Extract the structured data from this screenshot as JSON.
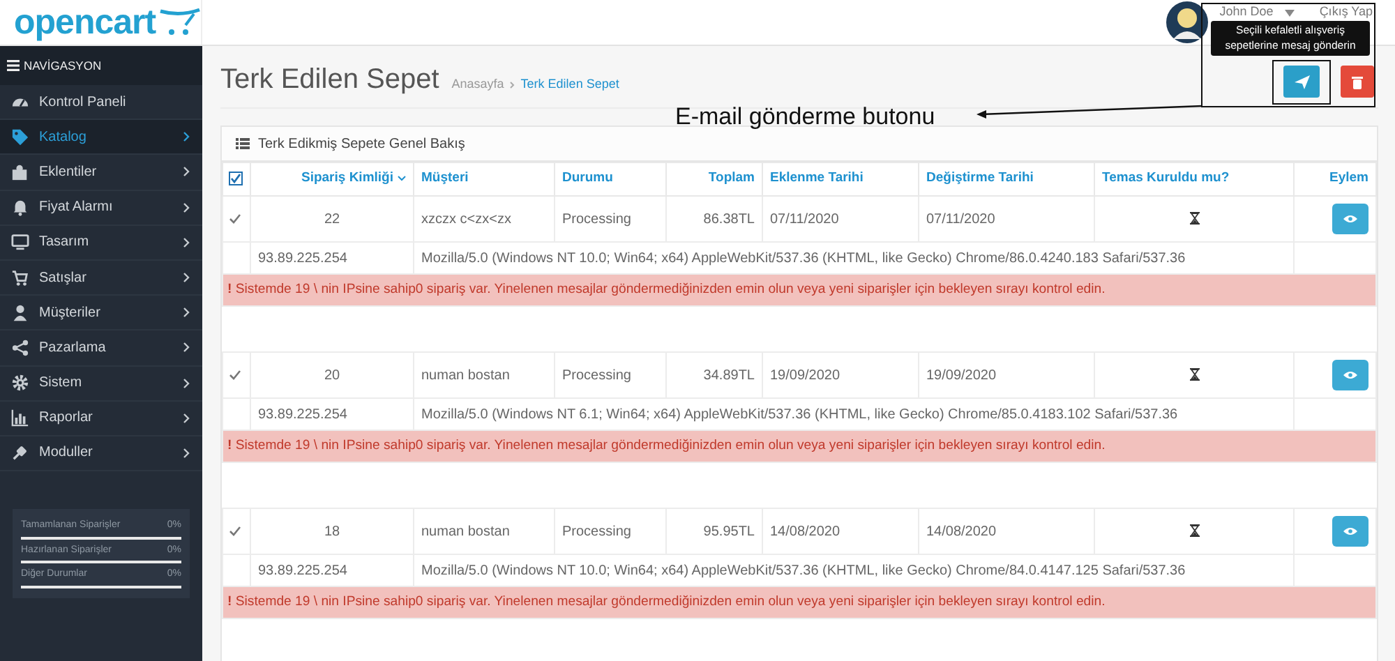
{
  "header": {
    "logo": "opencart",
    "user": "John Doe",
    "logout": "Çıkış Yap"
  },
  "sidebar": {
    "heading": "NAVİGASYON",
    "items": [
      {
        "label": "Kontrol Paneli",
        "selected": false,
        "has_children": false
      },
      {
        "label": "Katalog",
        "selected": true,
        "has_children": true
      },
      {
        "label": "Eklentiler",
        "selected": false,
        "has_children": true
      },
      {
        "label": "Fiyat Alarmı",
        "selected": false,
        "has_children": true
      },
      {
        "label": "Tasarım",
        "selected": false,
        "has_children": true
      },
      {
        "label": "Satışlar",
        "selected": false,
        "has_children": true
      },
      {
        "label": "Müşteriler",
        "selected": false,
        "has_children": true
      },
      {
        "label": "Pazarlama",
        "selected": false,
        "has_children": true
      },
      {
        "label": "Sistem",
        "selected": false,
        "has_children": true
      },
      {
        "label": "Raporlar",
        "selected": false,
        "has_children": true
      },
      {
        "label": "Moduller",
        "selected": false,
        "has_children": true
      }
    ],
    "stats": [
      {
        "label": "Tamamlanan Siparişler",
        "value": "0%",
        "level": 0
      },
      {
        "label": "Hazırlanan Siparişler",
        "value": "0%",
        "level": 0
      },
      {
        "label": "Diğer Durumlar",
        "value": "0%",
        "level": 0
      }
    ]
  },
  "page": {
    "title": "Terk Edilen Sepet",
    "breadcrumb": [
      {
        "label": "Anasayfa",
        "selected": false
      },
      {
        "label": "Terk Edilen Sepet",
        "selected": true
      }
    ]
  },
  "toolbar": {
    "tooltip": "Seçili kefaletli alışveriş sepetlerine mesaj gönderin"
  },
  "annotation": {
    "label": "E-mail gönderme butonu"
  },
  "panel": {
    "title": "Terk Edikmiş Sepete Genel Bakış",
    "select_all_checked": true,
    "columns": [
      {
        "label": "Sipariş Kimliği",
        "sorted": true
      },
      {
        "label": "Müşteri",
        "sorted": false
      },
      {
        "label": "Durumu",
        "sorted": false
      },
      {
        "label": "Toplam",
        "sorted": false
      },
      {
        "label": "Eklenme Tarihi",
        "sorted": false
      },
      {
        "label": "Değiştirme Tarihi",
        "sorted": false
      },
      {
        "label": "Temas Kuruldu mu?",
        "sorted": false
      },
      {
        "label": "Eylem",
        "sorted": false
      }
    ],
    "rows": [
      {
        "checked": true,
        "id": "22",
        "customer": "xzczx c<zx<zx",
        "status": "Processing",
        "total": "86.38TL",
        "added": "07/11/2020",
        "modified": "07/11/2020",
        "contacted": false,
        "ip": "93.89.225.254",
        "user_agent": "Mozilla/5.0 (Windows NT 10.0; Win64; x64) AppleWebKit/537.36 (KHTML, like Gecko) Chrome/86.0.4240.183 Safari/537.36",
        "alert": "**!** Sistemde 19 \\ nin IPsine sahip0 sipariş var. Yinelenen mesajlar göndermediğinizden emin olun veya yeni siparişler için bekleyen sırayı kontrol edin."
      },
      {
        "checked": true,
        "id": "20",
        "customer": "numan bostan",
        "status": "Processing",
        "total": "34.89TL",
        "added": "19/09/2020",
        "modified": "19/09/2020",
        "contacted": false,
        "ip": "93.89.225.254",
        "user_agent": "Mozilla/5.0 (Windows NT 6.1; Win64; x64) AppleWebKit/537.36 (KHTML, like Gecko) Chrome/85.0.4183.102 Safari/537.36",
        "alert": "**!** Sistemde 19 \\ nin IPsine sahip0 sipariş var. Yinelenen mesajlar göndermediğinizden emin olun veya yeni siparişler için bekleyen sırayı kontrol edin."
      },
      {
        "checked": true,
        "id": "18",
        "customer": "numan bostan",
        "status": "Processing",
        "total": "95.95TL",
        "added": "14/08/2020",
        "modified": "14/08/2020",
        "contacted": false,
        "ip": "93.89.225.254",
        "user_agent": "Mozilla/5.0 (Windows NT 10.0; Win64; x64) AppleWebKit/537.36 (KHTML, like Gecko) Chrome/84.0.4147.125 Safari/537.36",
        "alert": "**!** Sistemde 19 \\ nin IPsine sahip0 sipariş var. Yinelenen mesajlar göndermediğinizden emin olun veya yeni siparişler için bekleyen sırayı kontrol edin."
      }
    ]
  }
}
